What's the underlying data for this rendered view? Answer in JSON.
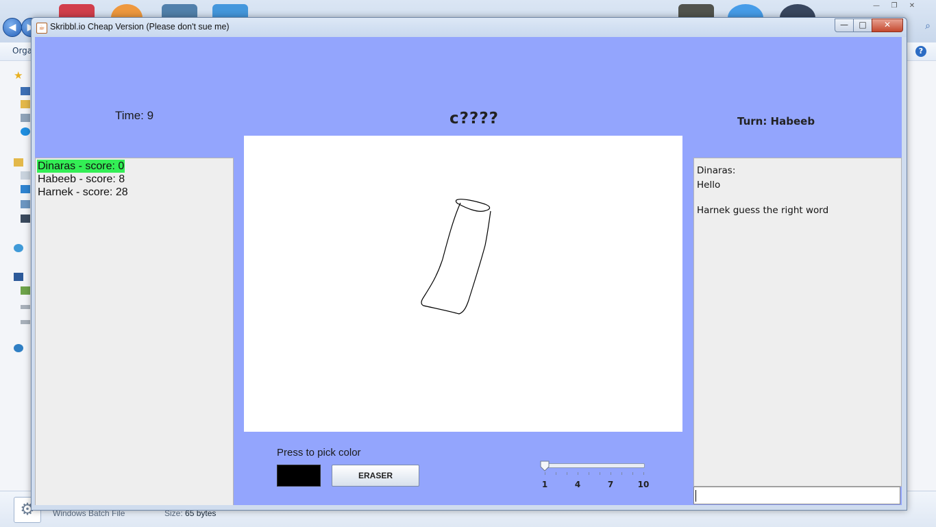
{
  "background": {
    "toolbar_label": "Orga",
    "status": {
      "file_type": "Windows Batch File",
      "size_label": "Size:",
      "size_value": "65 bytes"
    }
  },
  "window": {
    "title": "Skribbl.io Cheap Version (Please don't sue me)",
    "minimize": "—",
    "maximize": "□",
    "close": "✕"
  },
  "game": {
    "time": "Time: 9",
    "word_hint": "c????",
    "turn": "Turn: Habeeb"
  },
  "players": [
    {
      "label": "Dinaras - score: 0",
      "active": true
    },
    {
      "label": "Habeeb - score: 8",
      "active": false
    },
    {
      "label": "Harnek - score: 28",
      "active": false
    }
  ],
  "tools": {
    "pick_color_label": "Press to pick color",
    "current_color": "#000000",
    "eraser_label": "ERASER",
    "brush_size": {
      "value": 1,
      "min": 1,
      "max": 10,
      "tick_labels": [
        "1",
        "4",
        "7",
        "10"
      ]
    }
  },
  "chat": {
    "messages": [
      {
        "text": "Dinaras:"
      },
      {
        "text": "Hello"
      },
      {
        "text": "Harnek guess the right word"
      }
    ],
    "input_value": ""
  },
  "colors": {
    "game_background": "#93a5fd",
    "active_player_highlight": "#33ee55",
    "panel_background": "#eeeeee"
  }
}
